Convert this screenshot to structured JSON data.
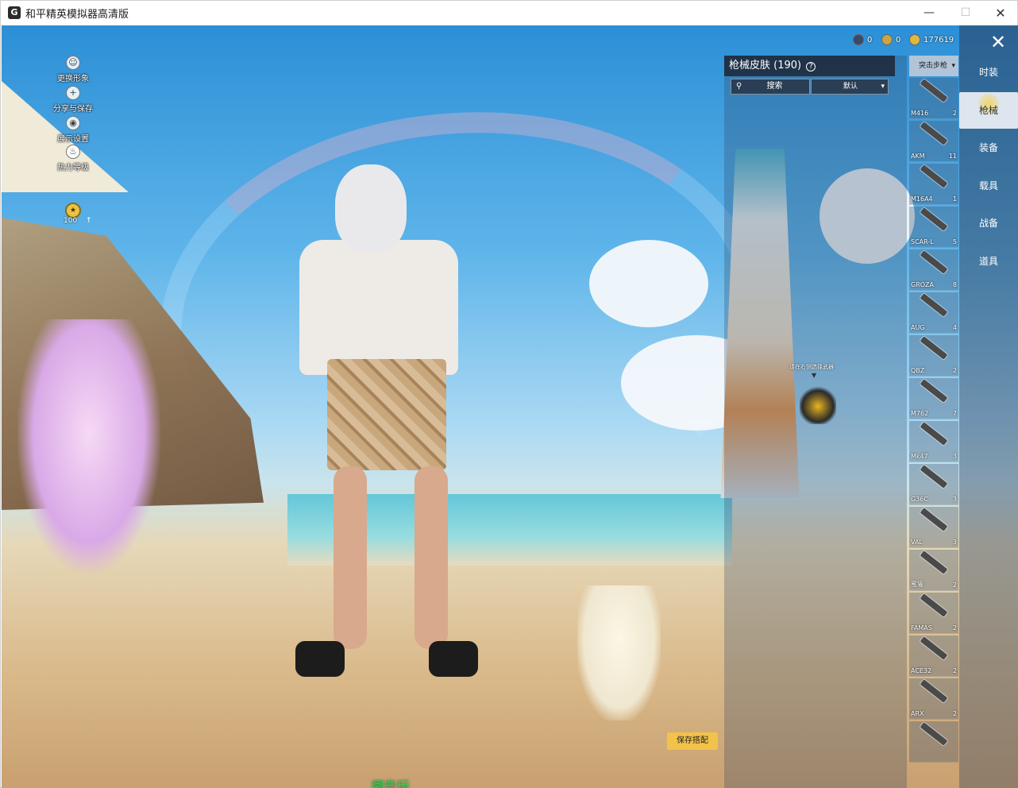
{
  "window": {
    "title": "和平精英模拟器高清版",
    "min": "—",
    "max": "☐",
    "close": "✕"
  },
  "left_menu": {
    "items": [
      {
        "label": "更换形象",
        "icon": "person-icon"
      },
      {
        "label": "分享与保存",
        "icon": "plus-icon"
      },
      {
        "label": "展示设置",
        "icon": "eye-icon"
      },
      {
        "label": "热力等级",
        "icon": "flame-icon"
      }
    ],
    "level": "100"
  },
  "currency": [
    {
      "value": "0",
      "color": "#3a4a6a"
    },
    {
      "value": "0",
      "color": "#c9a642"
    },
    {
      "value": "177619",
      "color": "#e2b83c"
    }
  ],
  "skin_panel": {
    "title": "枪械皮肤 (190)",
    "help_icon": "?",
    "search_placeholder": "搜索",
    "sort_label": "默认",
    "hint": "请在右侧选择武器"
  },
  "weapon_type": {
    "label": "突击步枪"
  },
  "weapons": [
    {
      "name": "M416",
      "count": "2"
    },
    {
      "name": "AKM",
      "count": "11"
    },
    {
      "name": "M16A4",
      "count": "1"
    },
    {
      "name": "SCAR-L",
      "count": "5"
    },
    {
      "name": "GROZA",
      "count": "8"
    },
    {
      "name": "AUG",
      "count": "4"
    },
    {
      "name": "QBZ",
      "count": "2"
    },
    {
      "name": "M762",
      "count": "7"
    },
    {
      "name": "Mk47",
      "count": "3"
    },
    {
      "name": "G36C",
      "count": "3"
    },
    {
      "name": "VAL",
      "count": "3"
    },
    {
      "name": "蜜獾",
      "count": "2"
    },
    {
      "name": "FAMAS",
      "count": "2"
    },
    {
      "name": "ACE32",
      "count": "2"
    },
    {
      "name": "ARX",
      "count": "2"
    },
    {
      "name": "",
      "count": ""
    }
  ],
  "nav": [
    {
      "label": "时装"
    },
    {
      "label": "枪械"
    },
    {
      "label": "装备"
    },
    {
      "label": "载具"
    },
    {
      "label": "战备"
    },
    {
      "label": "道具"
    }
  ],
  "save_button": "保存搭配",
  "bottom_banner": "哪些玩",
  "accent": "#f2c24a"
}
